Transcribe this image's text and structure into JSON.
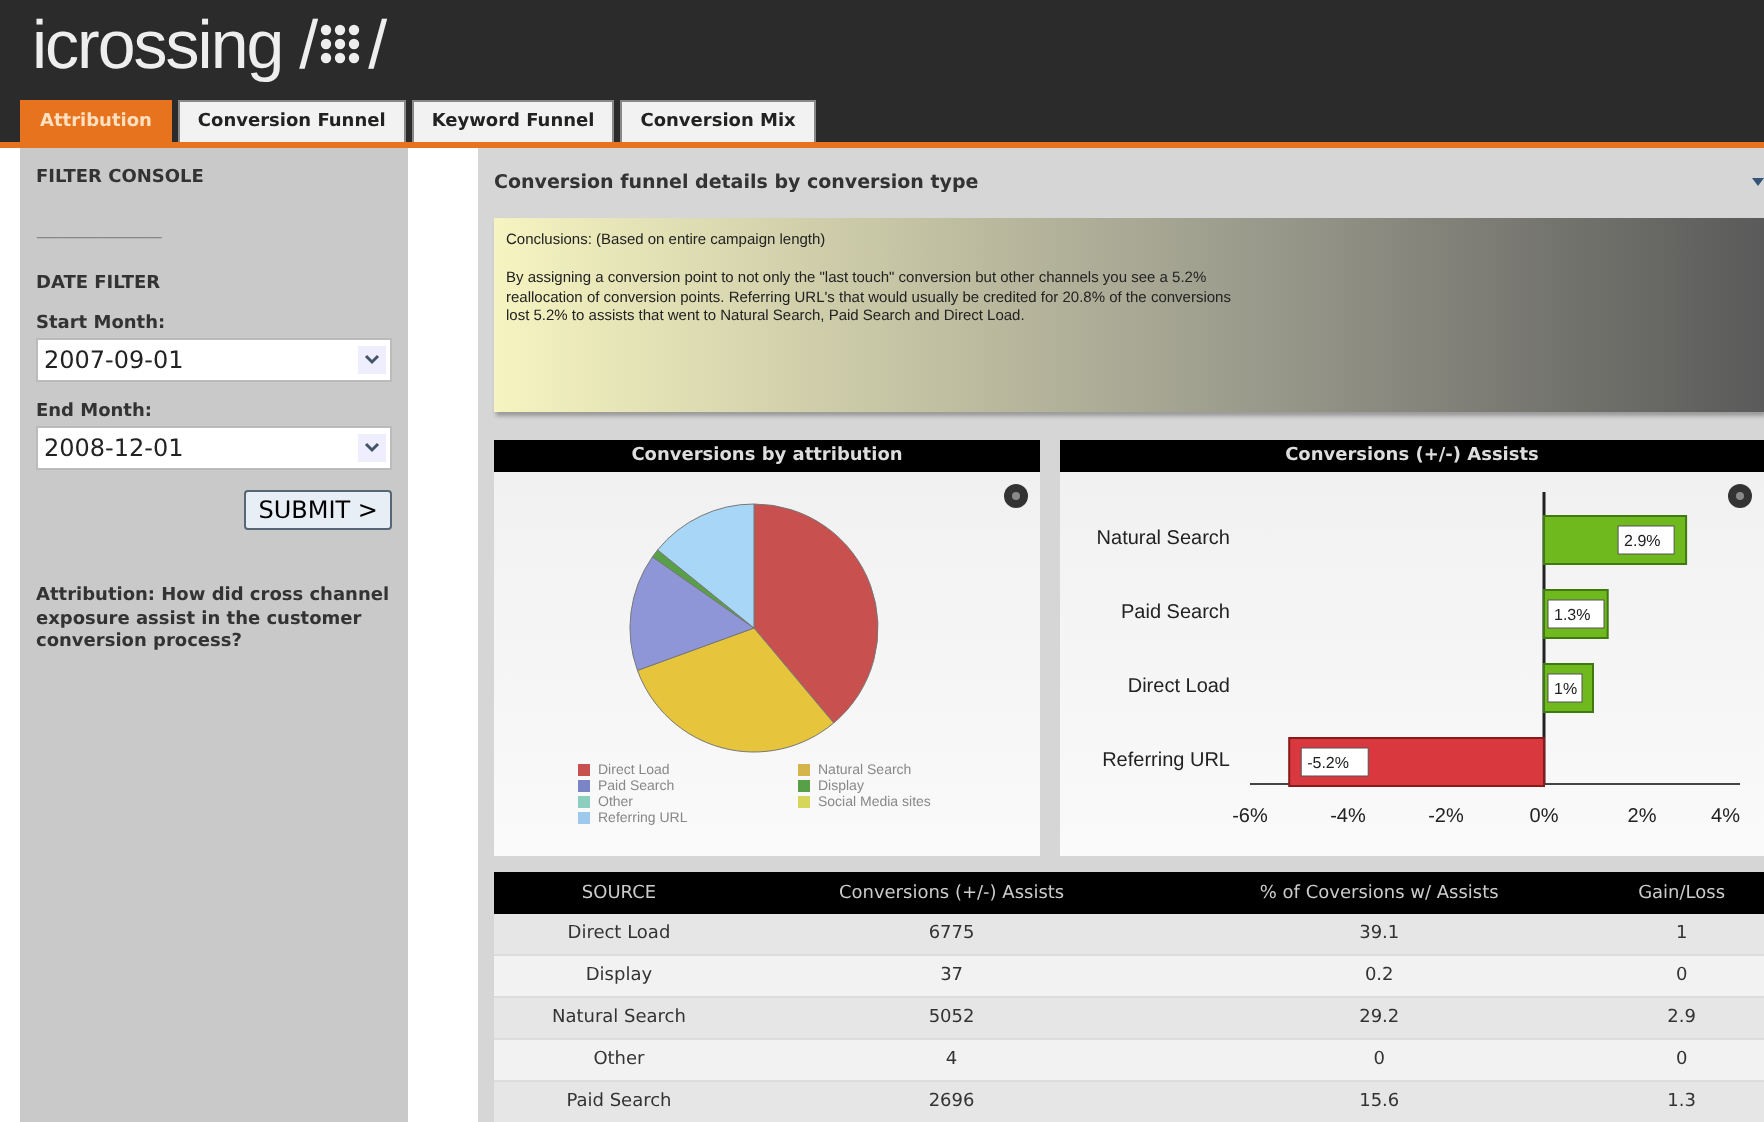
{
  "header": {
    "logo": "icrossing /",
    "logo_suffix": "/"
  },
  "tabs": [
    {
      "label": "Attribution",
      "selected": true
    },
    {
      "label": "Conversion Funnel",
      "selected": false
    },
    {
      "label": "Keyword Funnel",
      "selected": false
    },
    {
      "label": "Conversion Mix",
      "selected": false
    }
  ],
  "sidebar": {
    "title": "FILTER CONSOLE",
    "divider": "---------------------------------",
    "date_filter": "DATE FILTER",
    "fields": [
      {
        "label": "Start Month:",
        "value": "2007-09-01"
      },
      {
        "label": "End Month:",
        "value": "2008-12-01"
      }
    ],
    "submit": "SUBMIT >",
    "question": "Attribution: How did cross channel exposure assist in the customer conversion process?"
  },
  "main": {
    "title": "Conversion funnel details by conversion type",
    "conclusions": {
      "heading": "Conclusions: (Based on entire campaign length)",
      "lines": [
        "By assigning a conversion point to not only the \"last touch\" conversion but other channels you see a 5.2%",
        "reallocation of conversion points.  Referring URL's that would usually be credited for 20.8% of the conversions",
        "lost 5.2% to assists that went to Natural Search, Paid Search and Direct Load."
      ]
    },
    "pie": {
      "title": "Conversions by attribution",
      "legend": [
        {
          "label": "Direct Load",
          "color": "#c8504e"
        },
        {
          "label": "Natural Search",
          "color": "#d6b44c"
        },
        {
          "label": "Paid Search",
          "color": "#7b84c6"
        },
        {
          "label": "Display",
          "color": "#58a048"
        },
        {
          "label": "Other",
          "color": "#8ccfbe"
        },
        {
          "label": "Social Media sites",
          "color": "#d6d65a"
        },
        {
          "label": "Referring URL",
          "color": "#9dc9ee"
        }
      ]
    },
    "bars": {
      "title": "Conversions (+/-) Assists",
      "chart_data": {
        "type": "bar",
        "orientation": "horizontal",
        "categories": [
          "Natural Search",
          "Paid Search",
          "Direct Load",
          "Referring URL"
        ],
        "values": [
          2.9,
          1.3,
          1,
          -5.2
        ],
        "value_labels": [
          "2.9%",
          "1.3%",
          "1%",
          "-5.2%"
        ],
        "xlim": [
          -6,
          4
        ],
        "xticks": [
          {
            "value": -6,
            "label": "-6%"
          },
          {
            "value": -4,
            "label": "-4%"
          },
          {
            "value": -2,
            "label": "-2%"
          },
          {
            "value": 0,
            "label": "0%"
          },
          {
            "value": 2,
            "label": "2%"
          },
          {
            "value": 4,
            "label": "4%"
          }
        ]
      }
    },
    "table": {
      "columns": [
        "SOURCE",
        "Conversions (+/-) Assists",
        "% of Coversions w/ Assists",
        "Gain/Loss"
      ],
      "rows": [
        [
          "Direct Load",
          "6775",
          "39.1",
          "1"
        ],
        [
          "Display",
          "37",
          "0.2",
          "0"
        ],
        [
          "Natural Search",
          "5052",
          "29.2",
          "2.9"
        ],
        [
          "Other",
          "4",
          "0",
          "0"
        ],
        [
          "Paid Search",
          "2696",
          "15.6",
          "1.3"
        ]
      ]
    }
  }
}
